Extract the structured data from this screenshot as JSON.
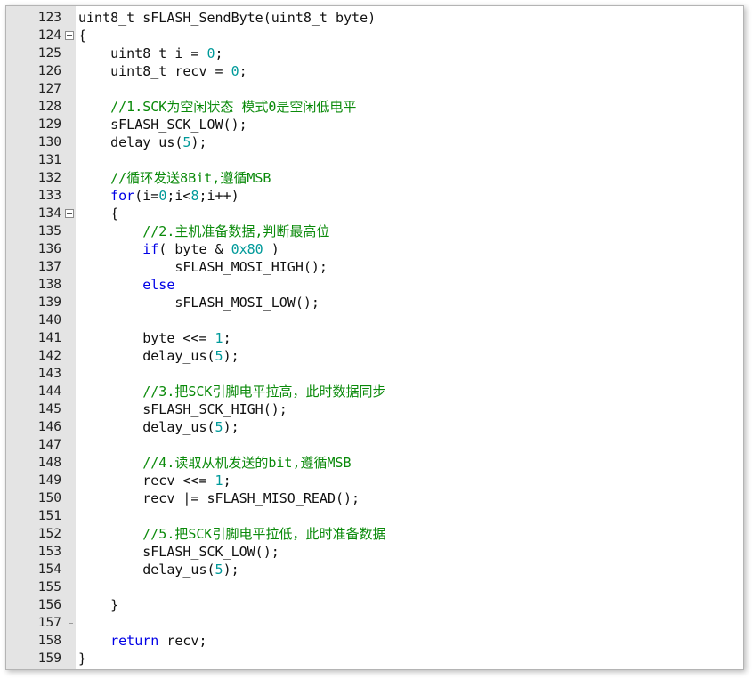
{
  "editor": {
    "language": "c",
    "colors": {
      "keyword": "#0000e6",
      "number": "#009a9a",
      "comment": "#0a8a0a",
      "text": "#111111",
      "gutter_bg": "#e4e4e4"
    },
    "lines": [
      {
        "num": "123",
        "fold": "",
        "tokens": [
          {
            "t": "id",
            "v": "uint8_t sFLASH_SendByte(uint8_t byte)"
          }
        ]
      },
      {
        "num": "124",
        "fold": "open",
        "tokens": [
          {
            "t": "id",
            "v": "{"
          }
        ]
      },
      {
        "num": "125",
        "fold": "",
        "tokens": [
          {
            "t": "id",
            "v": "    uint8_t i = "
          },
          {
            "t": "num",
            "v": "0"
          },
          {
            "t": "id",
            "v": ";"
          }
        ]
      },
      {
        "num": "126",
        "fold": "",
        "tokens": [
          {
            "t": "id",
            "v": "    uint8_t recv = "
          },
          {
            "t": "num",
            "v": "0"
          },
          {
            "t": "id",
            "v": ";"
          }
        ]
      },
      {
        "num": "127",
        "fold": "",
        "tokens": []
      },
      {
        "num": "128",
        "fold": "",
        "tokens": [
          {
            "t": "cm",
            "v": "    //1.SCK为空闲状态 模式0是空闲低电平"
          }
        ]
      },
      {
        "num": "129",
        "fold": "",
        "tokens": [
          {
            "t": "id",
            "v": "    sFLASH_SCK_LOW();"
          }
        ]
      },
      {
        "num": "130",
        "fold": "",
        "tokens": [
          {
            "t": "id",
            "v": "    delay_us("
          },
          {
            "t": "num",
            "v": "5"
          },
          {
            "t": "id",
            "v": ");"
          }
        ]
      },
      {
        "num": "131",
        "fold": "",
        "tokens": []
      },
      {
        "num": "132",
        "fold": "",
        "tokens": [
          {
            "t": "cm",
            "v": "    //循环发送8Bit,遵循MSB"
          }
        ]
      },
      {
        "num": "133",
        "fold": "",
        "tokens": [
          {
            "t": "kw",
            "v": "    for"
          },
          {
            "t": "id",
            "v": "(i="
          },
          {
            "t": "num",
            "v": "0"
          },
          {
            "t": "id",
            "v": ";i<"
          },
          {
            "t": "num",
            "v": "8"
          },
          {
            "t": "id",
            "v": ";i++)"
          }
        ]
      },
      {
        "num": "134",
        "fold": "open",
        "tokens": [
          {
            "t": "id",
            "v": "    {"
          }
        ]
      },
      {
        "num": "135",
        "fold": "",
        "tokens": [
          {
            "t": "cm",
            "v": "        //2.主机准备数据,判断最高位"
          }
        ]
      },
      {
        "num": "136",
        "fold": "",
        "tokens": [
          {
            "t": "kw",
            "v": "        if"
          },
          {
            "t": "id",
            "v": "( byte & "
          },
          {
            "t": "num",
            "v": "0x80"
          },
          {
            "t": "id",
            "v": " )"
          }
        ]
      },
      {
        "num": "137",
        "fold": "",
        "tokens": [
          {
            "t": "id",
            "v": "            sFLASH_MOSI_HIGH();"
          }
        ]
      },
      {
        "num": "138",
        "fold": "",
        "tokens": [
          {
            "t": "kw",
            "v": "        else"
          }
        ]
      },
      {
        "num": "139",
        "fold": "",
        "tokens": [
          {
            "t": "id",
            "v": "            sFLASH_MOSI_LOW();"
          }
        ]
      },
      {
        "num": "140",
        "fold": "",
        "tokens": []
      },
      {
        "num": "141",
        "fold": "",
        "tokens": [
          {
            "t": "id",
            "v": "        byte <<= "
          },
          {
            "t": "num",
            "v": "1"
          },
          {
            "t": "id",
            "v": ";"
          }
        ]
      },
      {
        "num": "142",
        "fold": "",
        "tokens": [
          {
            "t": "id",
            "v": "        delay_us("
          },
          {
            "t": "num",
            "v": "5"
          },
          {
            "t": "id",
            "v": ");"
          }
        ]
      },
      {
        "num": "143",
        "fold": "",
        "tokens": []
      },
      {
        "num": "144",
        "fold": "",
        "tokens": [
          {
            "t": "cm",
            "v": "        //3.把SCK引脚电平拉高，此时数据同步"
          }
        ]
      },
      {
        "num": "145",
        "fold": "",
        "tokens": [
          {
            "t": "id",
            "v": "        sFLASH_SCK_HIGH();"
          }
        ]
      },
      {
        "num": "146",
        "fold": "",
        "tokens": [
          {
            "t": "id",
            "v": "        delay_us("
          },
          {
            "t": "num",
            "v": "5"
          },
          {
            "t": "id",
            "v": ");"
          }
        ]
      },
      {
        "num": "147",
        "fold": "",
        "tokens": []
      },
      {
        "num": "148",
        "fold": "",
        "tokens": [
          {
            "t": "cm",
            "v": "        //4.读取从机发送的bit,遵循MSB"
          }
        ]
      },
      {
        "num": "149",
        "fold": "",
        "tokens": [
          {
            "t": "id",
            "v": "        recv <<= "
          },
          {
            "t": "num",
            "v": "1"
          },
          {
            "t": "id",
            "v": ";"
          }
        ]
      },
      {
        "num": "150",
        "fold": "",
        "tokens": [
          {
            "t": "id",
            "v": "        recv |= sFLASH_MISO_READ();"
          }
        ]
      },
      {
        "num": "151",
        "fold": "",
        "tokens": []
      },
      {
        "num": "152",
        "fold": "",
        "tokens": [
          {
            "t": "cm",
            "v": "        //5.把SCK引脚电平拉低，此时准备数据"
          }
        ]
      },
      {
        "num": "153",
        "fold": "",
        "tokens": [
          {
            "t": "id",
            "v": "        sFLASH_SCK_LOW();"
          }
        ]
      },
      {
        "num": "154",
        "fold": "",
        "tokens": [
          {
            "t": "id",
            "v": "        delay_us("
          },
          {
            "t": "num",
            "v": "5"
          },
          {
            "t": "id",
            "v": ");"
          }
        ]
      },
      {
        "num": "155",
        "fold": "",
        "tokens": []
      },
      {
        "num": "156",
        "fold": "",
        "tokens": [
          {
            "t": "id",
            "v": "    }"
          }
        ]
      },
      {
        "num": "157",
        "fold": "end",
        "tokens": []
      },
      {
        "num": "158",
        "fold": "",
        "tokens": [
          {
            "t": "kw",
            "v": "    return"
          },
          {
            "t": "id",
            "v": " recv;"
          }
        ]
      },
      {
        "num": "159",
        "fold": "",
        "tokens": [
          {
            "t": "id",
            "v": "}"
          }
        ]
      }
    ]
  }
}
